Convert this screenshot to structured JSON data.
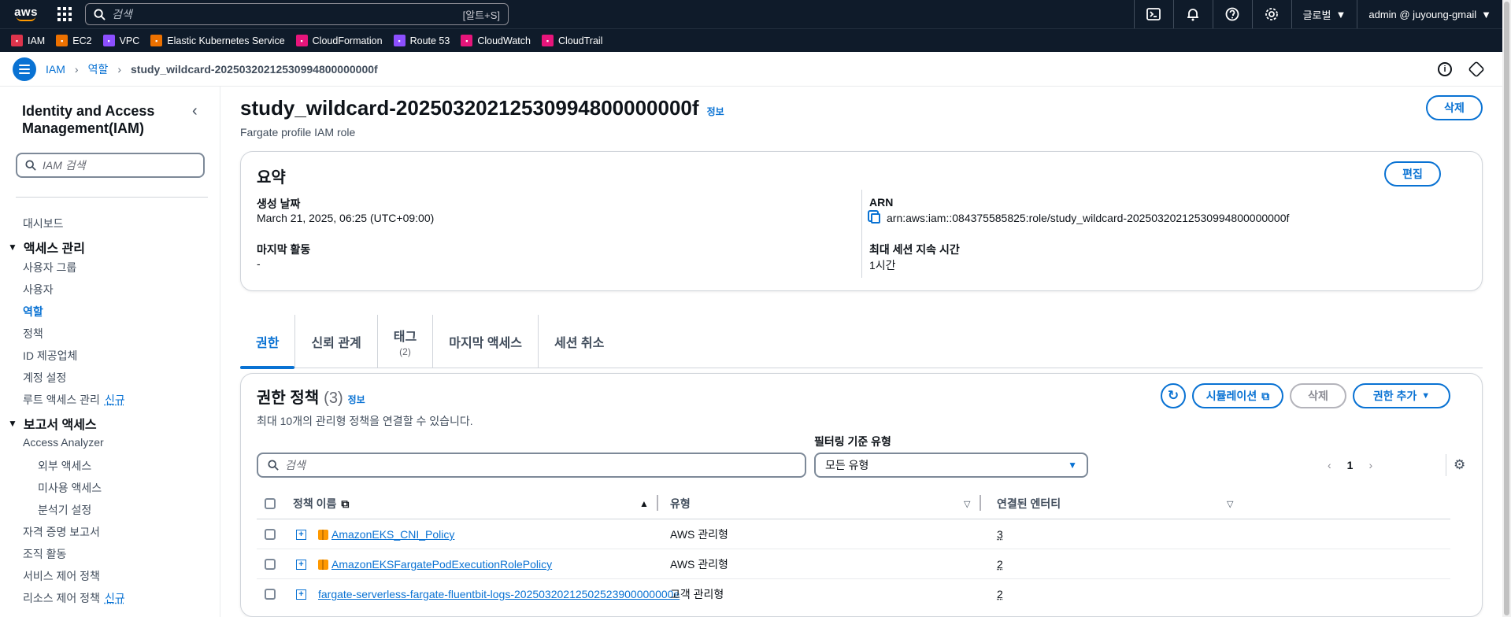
{
  "topnav": {
    "logo_text": "aws",
    "search_placeholder": "검색",
    "search_shortcut": "[알트+S]",
    "region": "글로벌",
    "account": "admin @ juyoung-gmail"
  },
  "favorites": [
    {
      "label": "IAM",
      "icon": "iam-icon",
      "color": "#dd344c"
    },
    {
      "label": "EC2",
      "icon": "ec2-icon",
      "color": "#ed7100"
    },
    {
      "label": "VPC",
      "icon": "vpc-icon",
      "color": "#8c4fff"
    },
    {
      "label": "Elastic Kubernetes Service",
      "icon": "eks-icon",
      "color": "#ed7100"
    },
    {
      "label": "CloudFormation",
      "icon": "cloudformation-icon",
      "color": "#e7157b"
    },
    {
      "label": "Route 53",
      "icon": "route53-icon",
      "color": "#8c4fff"
    },
    {
      "label": "CloudWatch",
      "icon": "cloudwatch-icon",
      "color": "#e7157b"
    },
    {
      "label": "CloudTrail",
      "icon": "cloudtrail-icon",
      "color": "#e7157b"
    }
  ],
  "breadcrumb": {
    "items": [
      "IAM",
      "역할"
    ],
    "current": "study_wildcard-20250320212530994800000000f"
  },
  "sidebar": {
    "title": "Identity and Access Management(IAM)",
    "search_placeholder": "IAM 검색",
    "dashboard": "대시보드",
    "access_section": "액세스 관리",
    "access_items": [
      "사용자 그룹",
      "사용자",
      "역할",
      "정책",
      "ID 제공업체",
      "계정 설정",
      "루트 액세스 관리"
    ],
    "new_badge": "신규",
    "report_section": "보고서 액세스",
    "access_analyzer": "Access Analyzer",
    "analyzer_items": [
      "외부 액세스",
      "미사용 액세스",
      "분석기 설정"
    ],
    "report_items": [
      "자격 증명 보고서",
      "조직 활동",
      "서비스 제어 정책",
      "리소스 제어 정책"
    ],
    "new_badge_2": "신규"
  },
  "page": {
    "title": "study_wildcard-20250320212530994800000000f",
    "info": "정보",
    "subtitle": "Fargate profile IAM role",
    "delete_button": "삭제"
  },
  "summary": {
    "heading": "요약",
    "edit_button": "편집",
    "created_label": "생성 날짜",
    "created_value": "March 21, 2025, 06:25 (UTC+09:00)",
    "last_activity_label": "마지막 활동",
    "last_activity_value": "-",
    "arn_label": "ARN",
    "arn_value": "arn:aws:iam::084375585825:role/study_wildcard-20250320212530994800000000f",
    "max_session_label": "최대 세션 지속 시간",
    "max_session_value": "1시간"
  },
  "tabs": [
    {
      "label": "권한",
      "count": ""
    },
    {
      "label": "신뢰 관계",
      "count": ""
    },
    {
      "label": "태그",
      "count": "(2)"
    },
    {
      "label": "마지막 액세스",
      "count": ""
    },
    {
      "label": "세션 취소",
      "count": ""
    }
  ],
  "permissions": {
    "heading": "권한 정책",
    "count": "(3)",
    "info": "정보",
    "description": "최대 10개의 관리형 정책을 연결할 수 있습니다.",
    "simulation_button": "시뮬레이션",
    "delete_button": "삭제",
    "add_button": "권한 추가",
    "filter_label": "필터링 기준 유형",
    "search_placeholder": "검색",
    "filter_value": "모든 유형",
    "page": "1",
    "columns": [
      "정책 이름",
      "유형",
      "연결된 엔터티"
    ],
    "rows": [
      {
        "name": "AmazonEKS_CNI_Policy",
        "type": "AWS 관리형",
        "entities": "3",
        "aws_managed": true
      },
      {
        "name": "AmazonEKSFargatePodExecutionRolePolicy",
        "type": "AWS 관리형",
        "entities": "2",
        "aws_managed": true
      },
      {
        "name": "fargate-serverless-fargate-fluentbit-logs-20250320212502523900000000e",
        "type": "고객 관리형",
        "entities": "2",
        "aws_managed": false
      }
    ]
  }
}
